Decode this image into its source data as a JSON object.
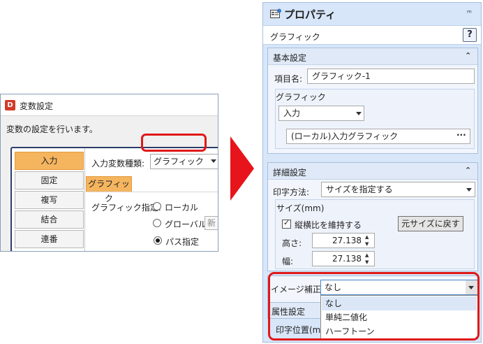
{
  "left_dialog": {
    "title": "変数設定",
    "logo_letter": "D",
    "description": "変数の設定を行います。",
    "tabs": [
      "入力",
      "固定",
      "複写",
      "結合",
      "連番"
    ],
    "input_var_type_label": "入力変数種類:",
    "input_var_type_value": "グラフィック",
    "graphic_tab": "グラフィック",
    "graphic_spec_label": "グラフィック指定:",
    "radio_options": [
      "ローカル",
      "グローバル",
      "パス指定"
    ],
    "selected_radio": "パス指定",
    "new_button": "新"
  },
  "properties_panel": {
    "title": "プロパティ",
    "subheader": "グラフィック",
    "help_label": "?",
    "basic": {
      "heading": "基本設定",
      "item_name_label": "項目名:",
      "item_name_value": "グラフィック-1",
      "graphic_label": "グラフィック",
      "input_value": "入力",
      "local_value": "(ローカル)入力グラフィック",
      "more_label": "···"
    },
    "detail": {
      "heading": "詳細設定",
      "print_method_label": "印字方法:",
      "print_method_value": "サイズを指定する",
      "size_label": "サイズ(mm)",
      "keep_ratio_label": "縦横比を維持する",
      "keep_ratio_checked": true,
      "restore_button": "元サイズに戻す",
      "height_label": "高さ:",
      "height_value": "27.138",
      "width_label": "幅:",
      "width_value": "27.138"
    },
    "image_correction": {
      "label": "イメージ補正:",
      "value": "なし",
      "options": [
        "なし",
        "単純二値化",
        "ハーフトーン"
      ]
    },
    "attributes": {
      "heading": "属性設定",
      "print_position_label": "印字位置(mm"
    }
  },
  "colors": {
    "highlight": "#e01818",
    "active_tab": "#f5b55f",
    "panel_bg": "#d7e6f9"
  }
}
